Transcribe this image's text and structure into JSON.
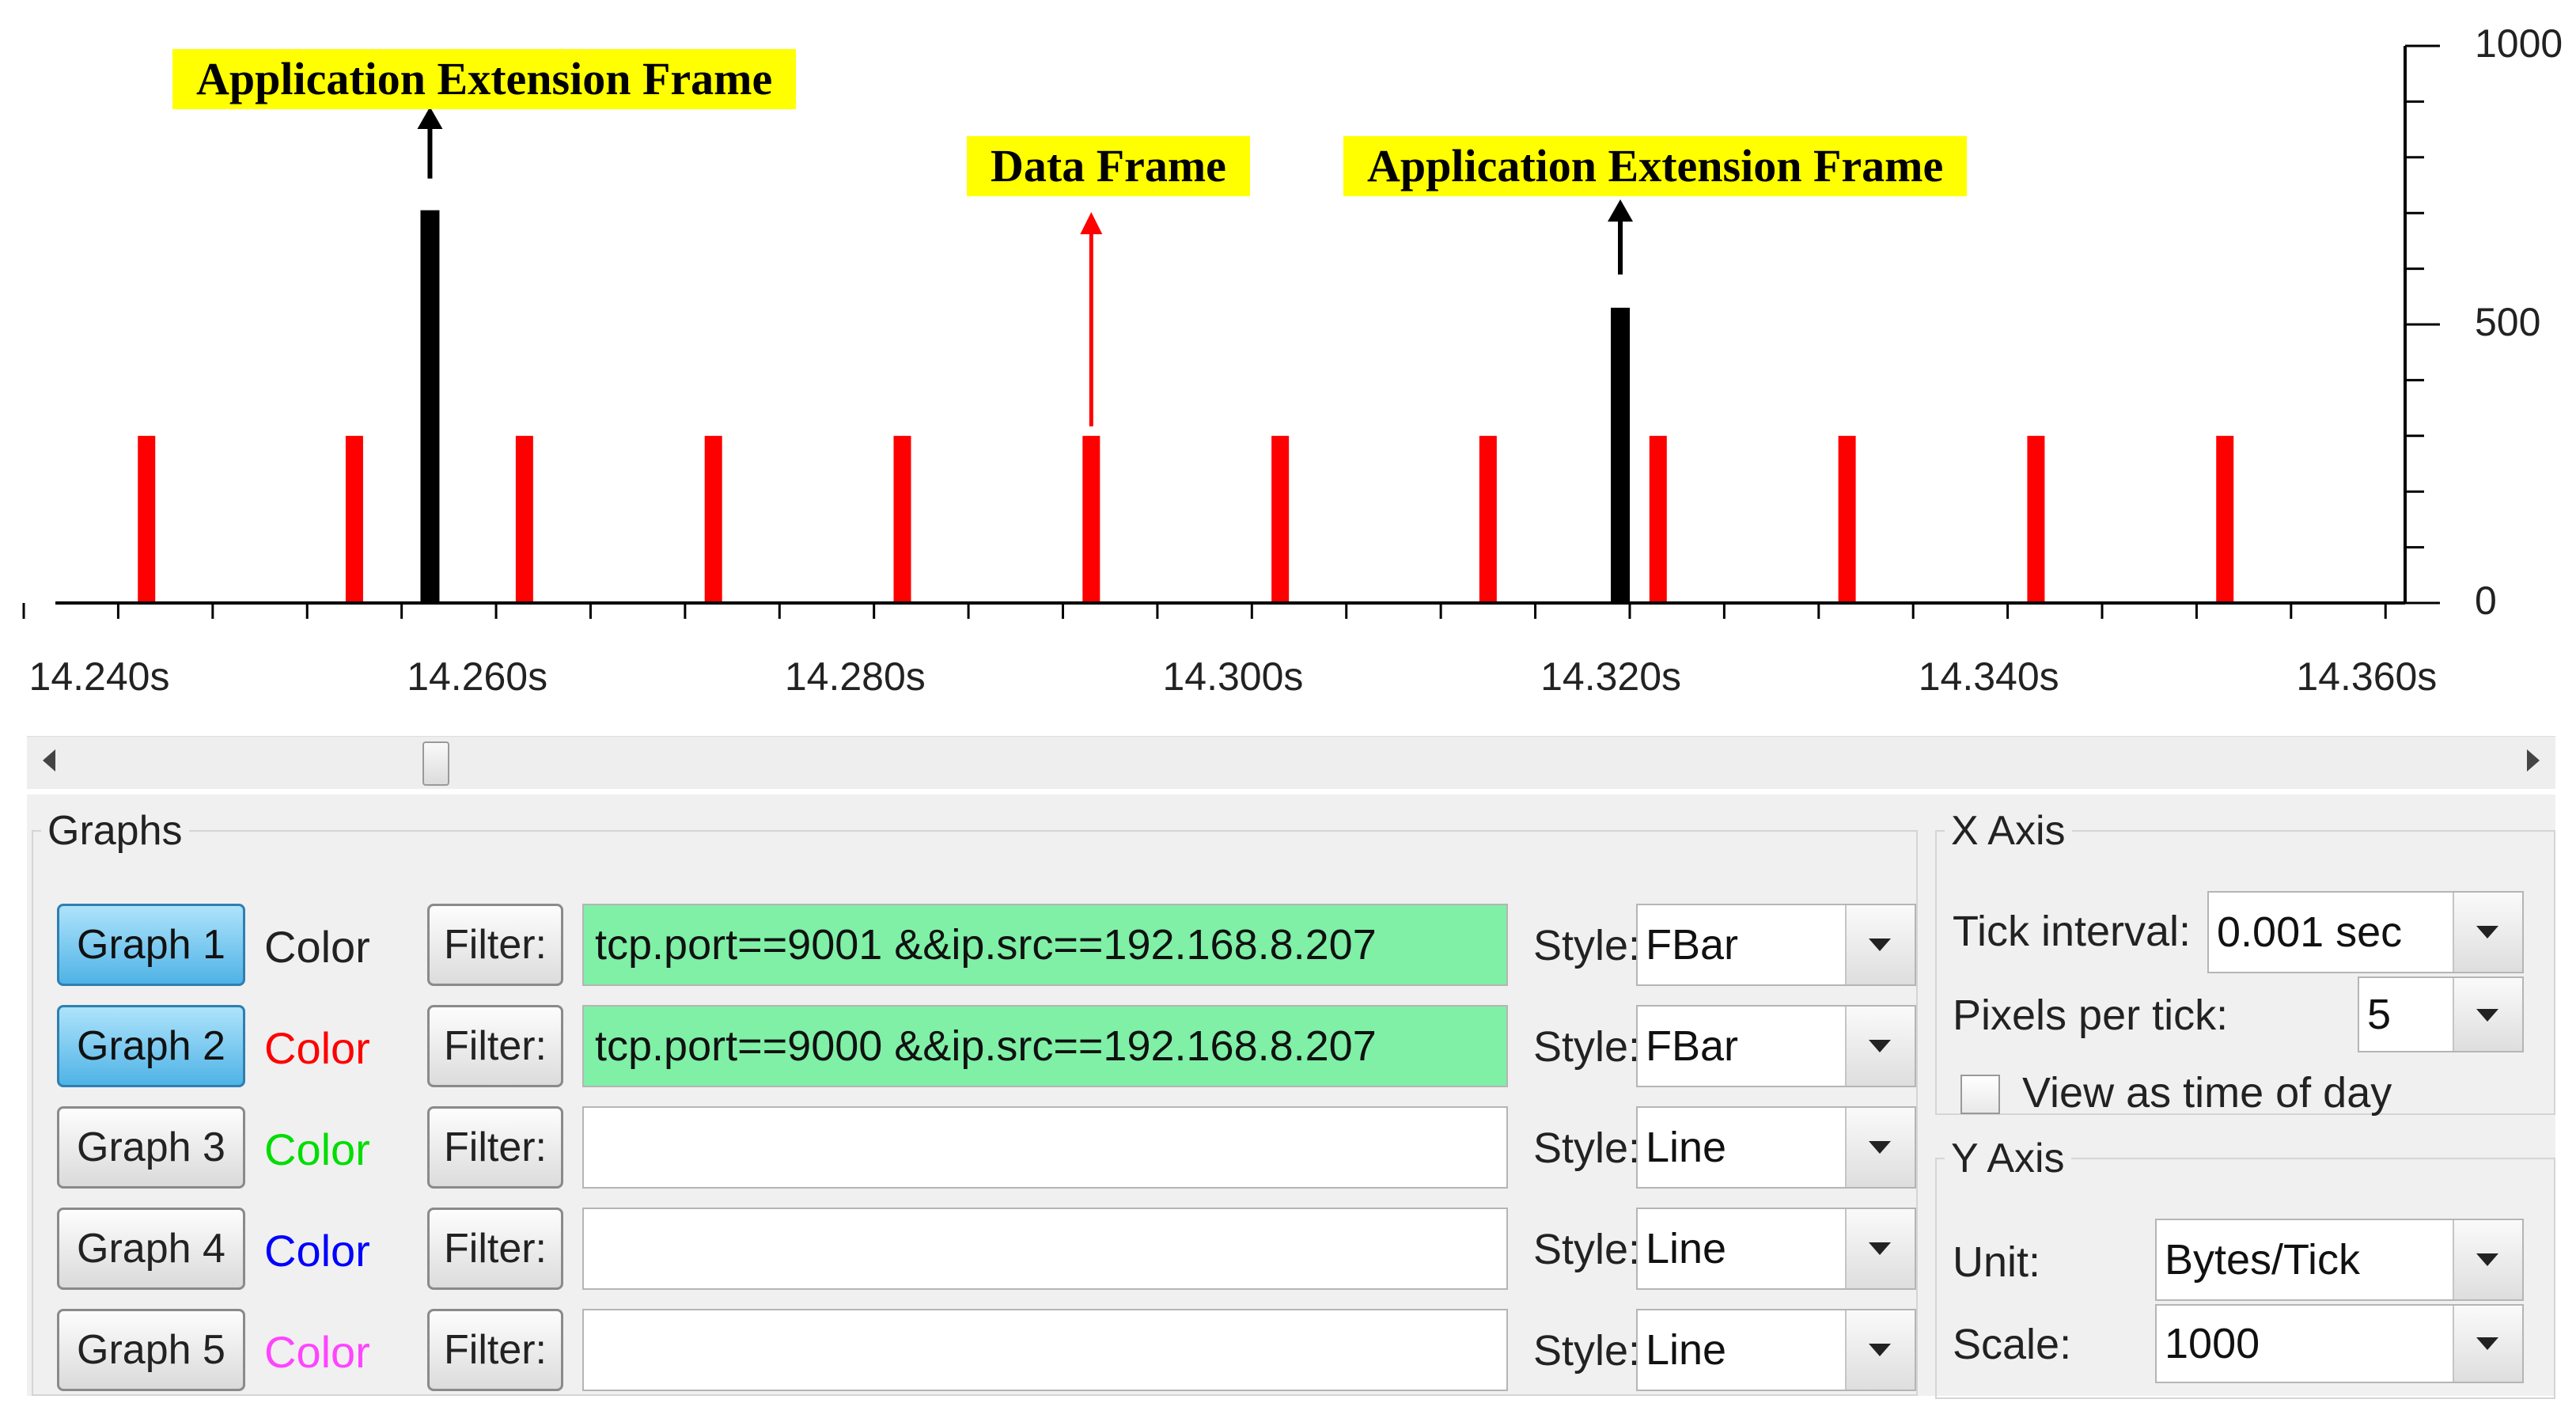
{
  "chart_data": {
    "type": "bar",
    "x_tick_labels": [
      "14.240s",
      "14.260s",
      "14.280s",
      "14.300s",
      "14.320s",
      "14.340s",
      "14.360s"
    ],
    "xlim": [
      14.236,
      14.363
    ],
    "y_tick_labels": [
      "1000",
      "500",
      "0"
    ],
    "ylim": [
      0,
      1000
    ],
    "series": [
      {
        "color": "#000000",
        "x": [
          14.2575,
          14.3205
        ],
        "values": [
          705,
          530
        ]
      },
      {
        "color": "#ff0000",
        "x": [
          14.2425,
          14.2535,
          14.2625,
          14.2725,
          14.2825,
          14.2925,
          14.3025,
          14.3135,
          14.3225,
          14.3325,
          14.3425,
          14.3525
        ],
        "values": [
          300,
          300,
          300,
          300,
          300,
          300,
          300,
          300,
          300,
          300,
          300,
          300
        ]
      }
    ],
    "annotations": [
      {
        "text": "Application Extension Frame",
        "x": 14.2575,
        "arrow_color": "#000000"
      },
      {
        "text": "Data Frame",
        "x": 14.2925,
        "arrow_color": "#ff0000"
      },
      {
        "text": "Application Extension Frame",
        "x": 14.3205,
        "arrow_color": "#000000"
      }
    ]
  },
  "graphs_panel": {
    "title": "Graphs",
    "style_label": "Style:",
    "filter_label": "Filter:",
    "rows": [
      {
        "button": "Graph 1",
        "color_label": "Color",
        "color": "#222222",
        "filter": "tcp.port==9001 &&ip.src==192.168.8.207",
        "style": "FBar",
        "active": true
      },
      {
        "button": "Graph 2",
        "color_label": "Color",
        "color": "#ff0000",
        "filter": "tcp.port==9000 &&ip.src==192.168.8.207",
        "style": "FBar",
        "active": true
      },
      {
        "button": "Graph 3",
        "color_label": "Color",
        "color": "#00dd00",
        "filter": "",
        "style": "Line",
        "active": false
      },
      {
        "button": "Graph 4",
        "color_label": "Color",
        "color": "#0000ff",
        "filter": "",
        "style": "Line",
        "active": false
      },
      {
        "button": "Graph 5",
        "color_label": "Color",
        "color": "#ff44ff",
        "filter": "",
        "style": "Line",
        "active": false
      }
    ]
  },
  "x_axis_panel": {
    "title": "X Axis",
    "tick_interval_label": "Tick interval:",
    "tick_interval_value": "0.001 sec",
    "pixels_per_tick_label": "Pixels per tick:",
    "pixels_per_tick_value": "5",
    "view_time_of_day_label": "View as time of day",
    "view_time_of_day_checked": false
  },
  "y_axis_panel": {
    "title": "Y Axis",
    "unit_label": "Unit:",
    "unit_value": "Bytes/Tick",
    "scale_label": "Scale:",
    "scale_value": "1000"
  }
}
